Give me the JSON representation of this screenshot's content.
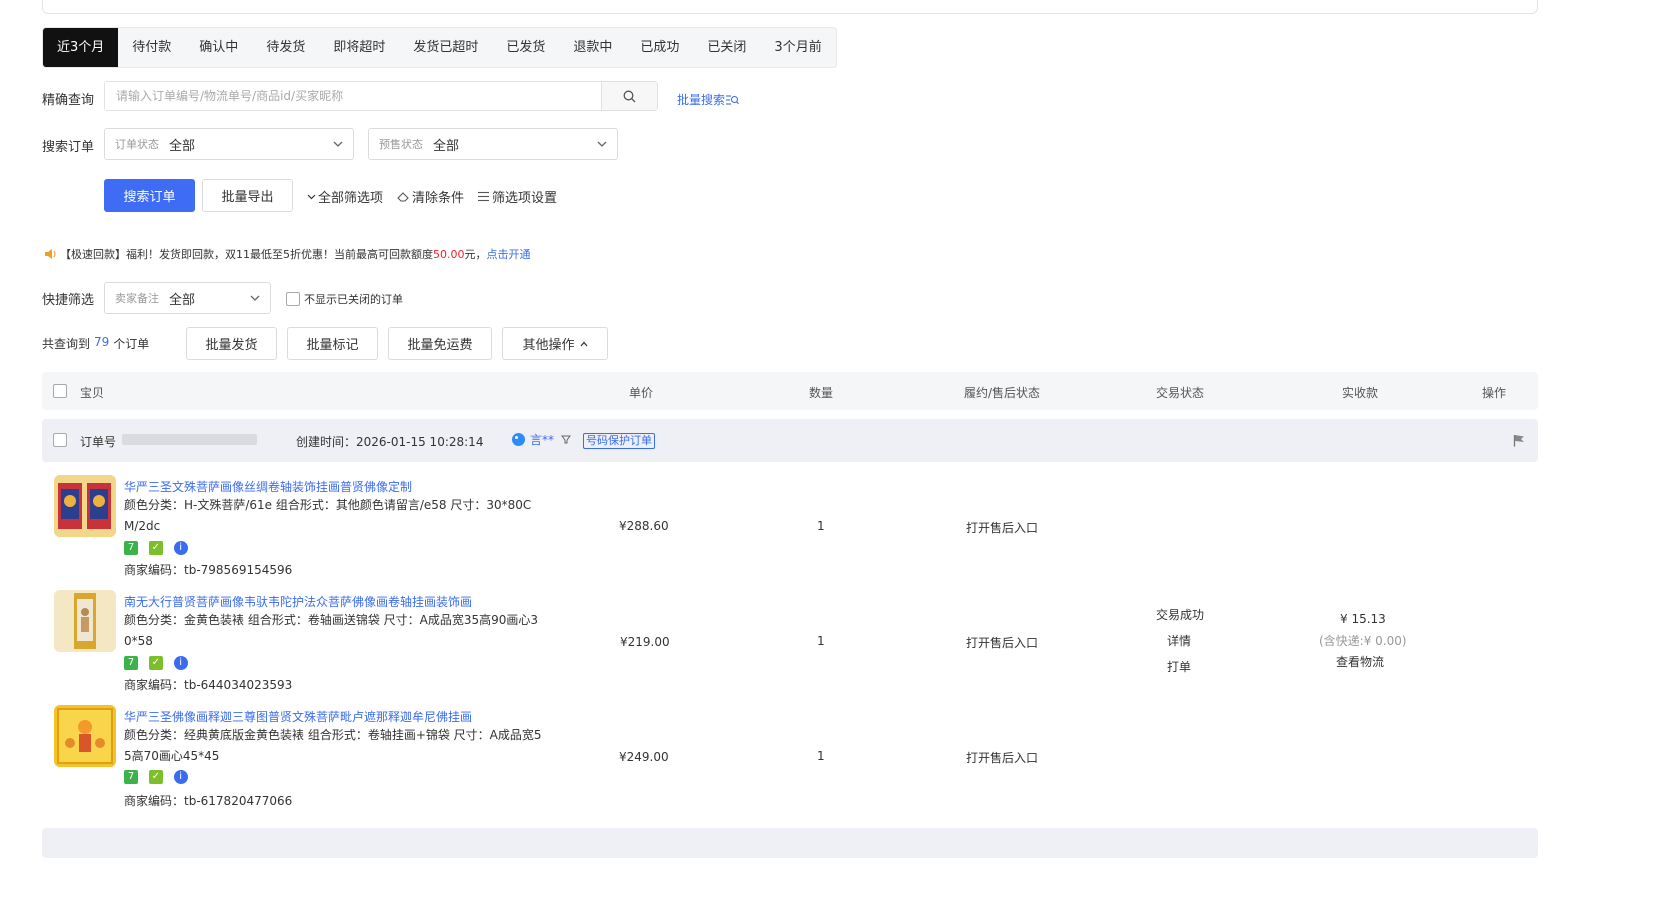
{
  "tabs": [
    "近3个月",
    "待付款",
    "确认中",
    "待发货",
    "即将超时",
    "发货已超时",
    "已发货",
    "退款中",
    "已成功",
    "已关闭",
    "3个月前"
  ],
  "exact_query": {
    "label": "精确查询",
    "placeholder": "请输入订单编号/物流单号/商品id/买家昵称",
    "batch_search": "批量搜索"
  },
  "search_orders": {
    "label": "搜索订单",
    "status_label": "订单状态",
    "status_value": "全部",
    "presale_label": "预售状态",
    "presale_value": "全部"
  },
  "actions": {
    "search": "搜索订单",
    "export": "批量导出",
    "all_filters": "全部筛选项",
    "clear": "清除条件",
    "filter_settings": "筛选项设置"
  },
  "notice": {
    "text1": "【极速回款】福利！发货即回款，双11最低至5折优惠！当前最高可回款额度",
    "amount": "50.00",
    "text2": "元，",
    "link": "点击开通"
  },
  "quick_filter": {
    "label": "快捷筛选",
    "remark_label": "卖家备注",
    "remark_value": "全部",
    "hide_closed": "不显示已关闭的订单"
  },
  "summary": {
    "prefix": "共查询到",
    "count": "79",
    "suffix": "个订单",
    "batch_ship": "批量发货",
    "batch_mark": "批量标记",
    "batch_free_ship": "批量免运费",
    "other": "其他操作"
  },
  "table_headers": {
    "item": "宝贝",
    "price": "单价",
    "qty": "数量",
    "fulfill": "履约/售后状态",
    "trade": "交易状态",
    "paid": "实收款",
    "ops": "操作"
  },
  "order": {
    "no_label": "订单号",
    "created": "创建时间：2026-01-15 10:28:14",
    "buyer": "言**",
    "protect_tag": "号码保护订单",
    "trade_status": "交易成功",
    "detail": "详情",
    "print": "打单",
    "paid": "¥ 15.13",
    "shipping": "(含快递:¥ 0.00)",
    "logistics": "查看物流",
    "items": [
      {
        "title": "华严三圣文殊菩萨画像丝绸卷轴装饰挂画普贤佛像定制",
        "attr": "颜色分类：H-文殊菩萨/61e  组合形式：其他颜色请留言/e58  尺寸：30*80CM/2dc",
        "code": "商家编码：tb-798569154596",
        "price": "¥288.60",
        "qty": "1",
        "after_sale": "打开售后入口"
      },
      {
        "title": "南无大行普贤菩萨画像韦驮韦陀护法众菩萨佛像画卷轴挂画装饰画",
        "attr": "颜色分类：金黄色装裱  组合形式：卷轴画送锦袋  尺寸：A成品宽35高90画心30*58",
        "code": "商家编码：tb-644034023593",
        "price": "¥219.00",
        "qty": "1",
        "after_sale": "打开售后入口"
      },
      {
        "title": "华严三圣佛像画释迦三尊图普贤文殊菩萨毗卢遮那释迦牟尼佛挂画",
        "attr": "颜色分类：经典黄底版金黄色装裱  组合形式：卷轴挂画+锦袋  尺寸：A成品宽55高70画心45*45",
        "code": "商家编码：tb-617820477066",
        "price": "¥249.00",
        "qty": "1",
        "after_sale": "打开售后入口"
      }
    ]
  },
  "colors": {
    "primary": "#3f6cf5",
    "link": "#3a6cf0",
    "active_tab": "#111111",
    "amount": "#f5222d"
  }
}
